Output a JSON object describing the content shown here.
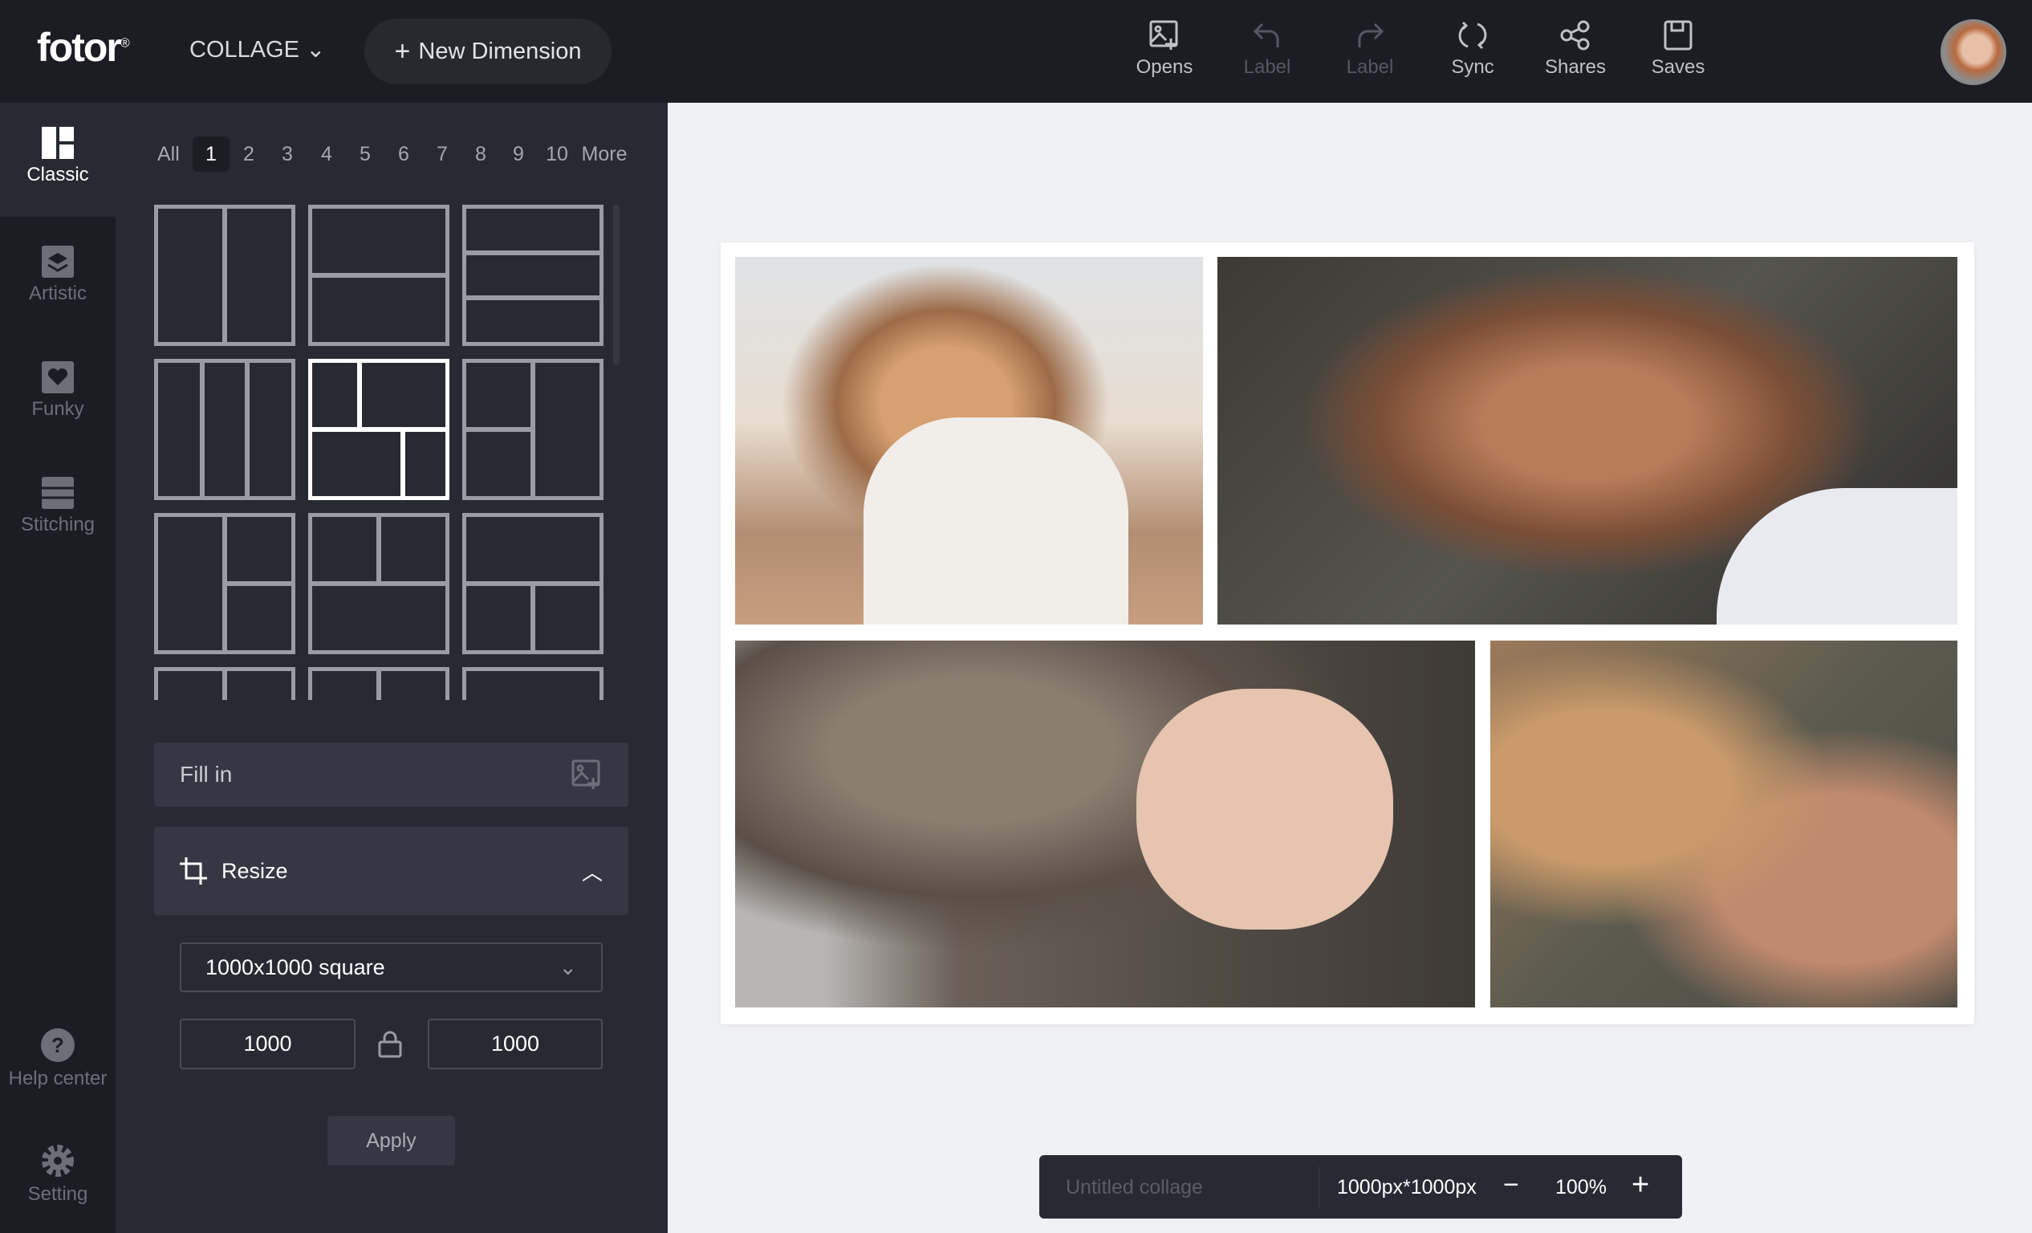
{
  "header": {
    "logo": "fotor",
    "logo_mark": "®",
    "mode": "COLLAGE",
    "new_dimension": "New Dimension",
    "tools": [
      {
        "label": "Opens",
        "icon": "image-add-icon",
        "enabled": true
      },
      {
        "label": "Label",
        "icon": "undo-icon",
        "enabled": false
      },
      {
        "label": "Label",
        "icon": "redo-icon",
        "enabled": false
      },
      {
        "label": "Sync",
        "icon": "sync-icon",
        "enabled": true
      },
      {
        "label": "Shares",
        "icon": "share-icon",
        "enabled": true
      },
      {
        "label": "Saves",
        "icon": "save-icon",
        "enabled": true
      }
    ]
  },
  "rail": {
    "items": [
      {
        "label": "Classic",
        "active": true
      },
      {
        "label": "Artistic"
      },
      {
        "label": "Funky"
      },
      {
        "label": "Stitching"
      }
    ],
    "help": "Help center",
    "setting": "Setting"
  },
  "panel": {
    "pages": [
      "All",
      "1",
      "2",
      "3",
      "4",
      "5",
      "6",
      "7",
      "8",
      "9",
      "10",
      "More"
    ],
    "active_page": "1",
    "fill_in": "Fill in",
    "resize": "Resize",
    "size_preset": "1000x1000 square",
    "width": "1000",
    "height": "1000",
    "apply": "Apply"
  },
  "bottom_bar": {
    "title_placeholder": "Untitled collage",
    "dimensions": "1000px*1000px",
    "zoom": "100%"
  },
  "colors": {
    "header_bg": "#1c1d24",
    "panel_bg": "#272a33",
    "canvas_bg": "#f0f1f5"
  }
}
